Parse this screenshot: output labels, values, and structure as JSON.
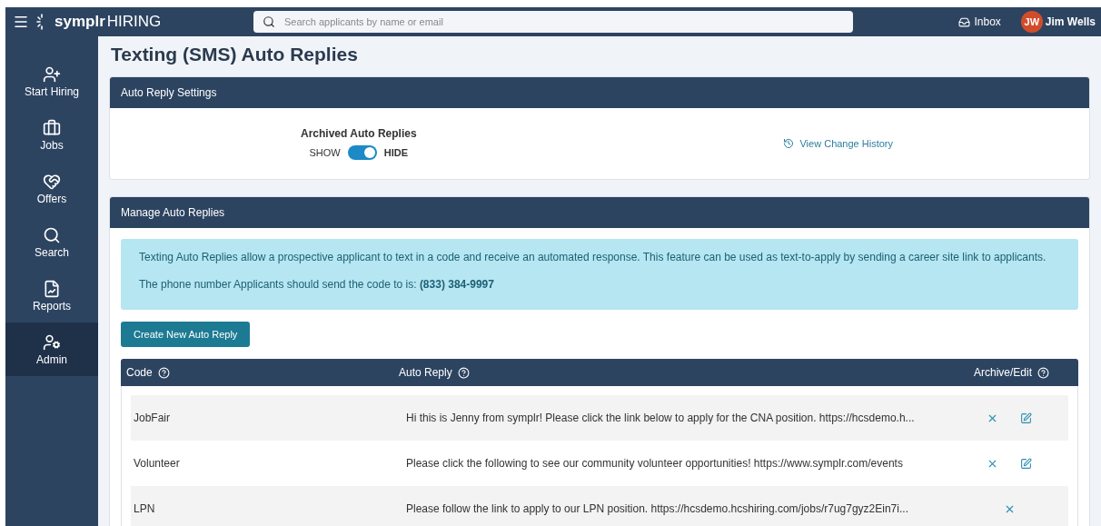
{
  "topbar": {
    "brand": "symplr",
    "product": "HIRING",
    "search": {
      "placeholder": "Search applicants by name or email"
    },
    "inbox": "Inbox",
    "user": {
      "initials": "JW",
      "name": "Jim Wells"
    }
  },
  "sidebar": {
    "items": [
      {
        "label": "Start Hiring",
        "selected": false
      },
      {
        "label": "Jobs",
        "selected": false
      },
      {
        "label": "Offers",
        "selected": false
      },
      {
        "label": "Search",
        "selected": false
      },
      {
        "label": "Reports",
        "selected": false
      },
      {
        "label": "Admin",
        "selected": true
      }
    ]
  },
  "page_title": "Texting (SMS) Auto Replies",
  "settings": {
    "title": "Auto Reply Settings",
    "toggle_label": "Archived Auto Replies",
    "off_label": "SHOW",
    "on_label": "HIDE",
    "on": true,
    "history_link": "View Change History"
  },
  "manage": {
    "title": "Manage Auto Replies",
    "info": [
      "Texting Auto Replies allow a prospective applicant to text in a code and receive an automated response. This feature can be used as text-to-apply by sending a career site link to applicants.",
      "The phone number Applicants should send the code to is: **(833) 384-9997**"
    ],
    "create_button": "Create New Auto Reply",
    "table": {
      "columns": [
        "Code",
        "Auto Reply",
        "Archive/Edit"
      ],
      "rows": [
        {
          "code": "JobFair",
          "reply": "Hi this is Jenny from symplr! Please click the link below to apply for the CNA position. https://hcsdemo.h...",
          "editable": true
        },
        {
          "code": "Volunteer",
          "reply": "Please click the following to see our community volunteer opportunities! https://www.symplr.com/events",
          "editable": true
        },
        {
          "code": "LPN",
          "reply": "Please follow the link to apply to our LPN position. https://hcsdemo.hcshiring.com/jobs/r7ug7gyz2Ein7i...",
          "editable": false
        }
      ]
    }
  }
}
